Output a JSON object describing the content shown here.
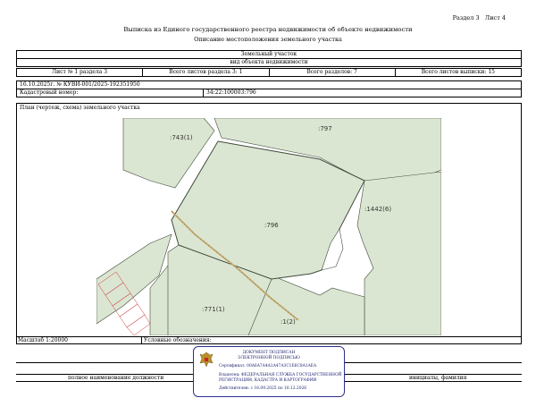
{
  "header": {
    "section_label": "Раздел 3",
    "sheet_label": "Лист 4",
    "title": "Выписка из Единого государственного реестра недвижимости об объекте недвижимости",
    "subtitle": "Описание местоположения земельного участка"
  },
  "object_block": {
    "object_type": "Земельный участок",
    "object_type_caption": "вид объекта недвижимости",
    "sheet_of_section": "Лист № 1 раздела 3",
    "sheets_in_section": "Всего листов раздела 3: 1",
    "sections_total": "Всего разделов: 7",
    "sheets_total": "Всего листов выписки: 15",
    "date_number": "16.10.2025г. № КУВИ-001/2025-192351950",
    "cadastral_label": "Кадастровый номер:",
    "cadastral_value": "34:22:100003:796",
    "plan_label": "План (чертеж, схема) земельного участка"
  },
  "map": {
    "labels": {
      "p743": ":743(1)",
      "p797": ":797",
      "p796": ":796",
      "p1442": ":1442(6)",
      "p771": ":771(1)",
      "p12": ":1(2)"
    }
  },
  "footer": {
    "scale_label": "Масштаб 1:20000",
    "legend_label": "Условные обозначения:",
    "position_caption": "полное наименование должности",
    "name_caption": "инициалы, фамилия"
  },
  "stamp": {
    "title1": "ДОКУМЕНТ ПОДПИСАН",
    "title2": "ЭЛЕКТРОННОЙ ПОДПИСЬЮ",
    "cert_line": "Сертификат: 00A6A7A4A1A47A3C1E6C8A1AEA",
    "owner_line1": "Владелец: ФЕДЕРАЛЬНАЯ СЛУЖБА ГОСУДАРСТВЕННОЙ",
    "owner_line2": "РЕГИСТРАЦИИ, КАДАСТРА И КАРТОГРАФИИ",
    "valid_line": "Действителен: с 16.09.2025 по 10.12.2026"
  },
  "colors": {
    "map_fill": "#dbe6d2",
    "map_line": "#3f4a3c",
    "stamp_border": "#2b2f8f",
    "road": "#c8b07a"
  }
}
